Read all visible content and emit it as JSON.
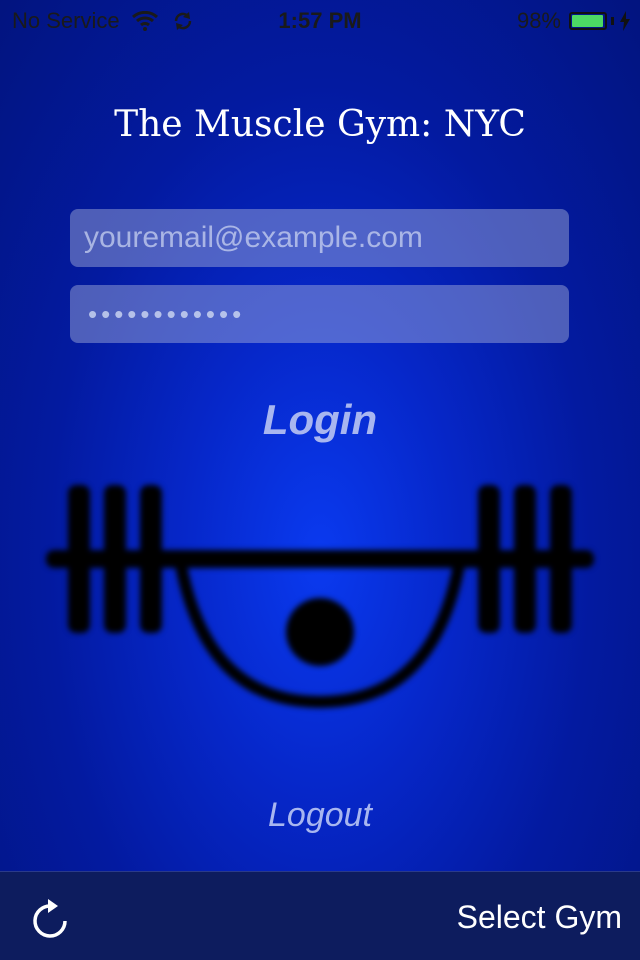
{
  "status_bar": {
    "carrier": "No Service",
    "time": "1:57 PM",
    "battery_percent": "98%",
    "battery_level": 0.98,
    "battery_color": "#4cd964"
  },
  "header": {
    "title": "The Muscle Gym: NYC"
  },
  "form": {
    "email_placeholder": "youremail@example.com",
    "email_value": "",
    "password_masked": "••••••••••••"
  },
  "actions": {
    "login_label": "Login",
    "logout_label": "Logout"
  },
  "toolbar": {
    "refresh_icon": "refresh-icon",
    "select_gym_label": "Select Gym"
  },
  "colors": {
    "background": "#0627c9",
    "toolbar": "#0d1c5e",
    "accent_text": "#a8b6f0"
  }
}
